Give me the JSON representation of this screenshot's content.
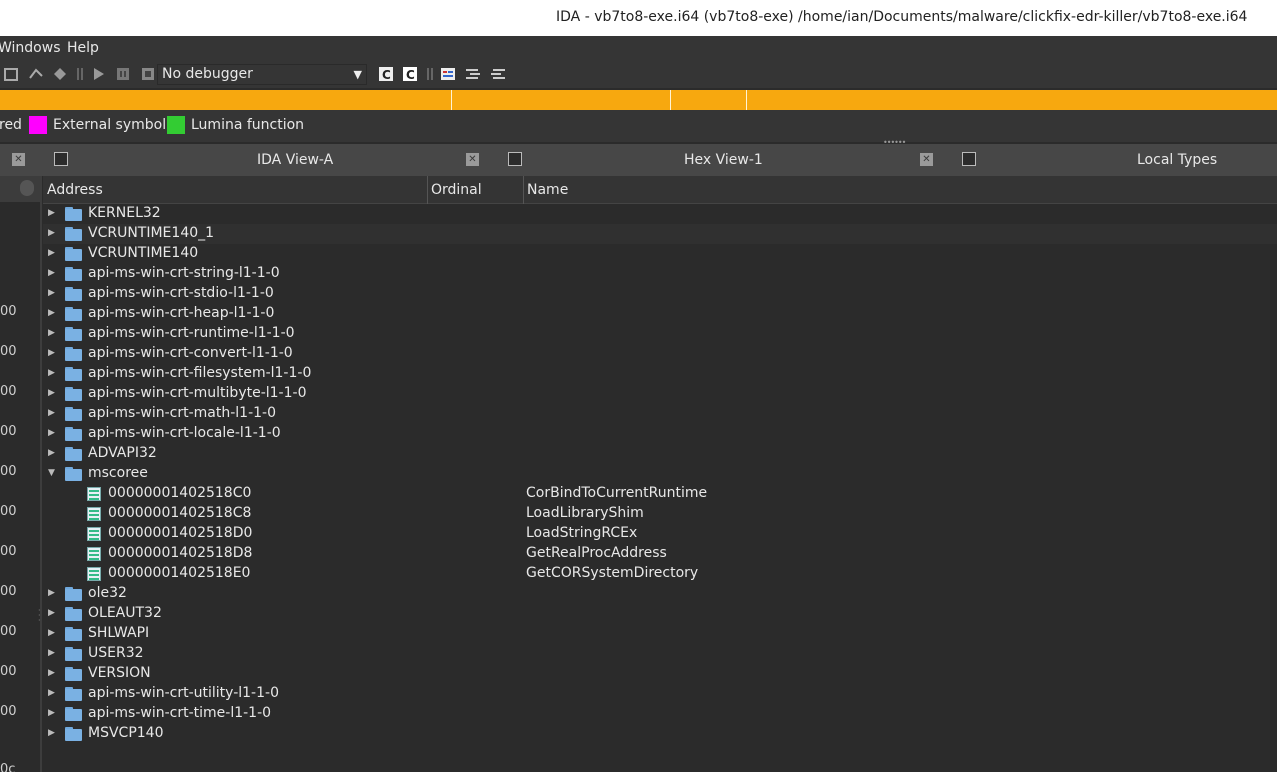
{
  "window": {
    "title": "IDA - vb7to8-exe.i64 (vb7to8-exe) /home/ian/Documents/malware/clickfix-edr-killer/vb7to8-exe.i64"
  },
  "menu": {
    "items": [
      "Windows",
      "Help"
    ]
  },
  "toolbar": {
    "debugger": "No debugger"
  },
  "legend": {
    "items": [
      {
        "label": "red",
        "color": ""
      },
      {
        "label": "External symbol",
        "color": "#ff00ff"
      },
      {
        "label": "Lumina function",
        "color": "#33cc33"
      }
    ]
  },
  "colors": {
    "nav_band": "#f7a80f",
    "folder": "#7ab1e3"
  },
  "tabs": [
    {
      "label": "IDA View-A",
      "icon": "list-icon"
    },
    {
      "label": "Hex View-1",
      "icon": "hex-icon"
    },
    {
      "label": "Local Types",
      "icon": "types-icon"
    }
  ],
  "columns": {
    "address": "Address",
    "ordinal": "Ordinal",
    "name": "Name"
  },
  "left_fragments": [
    "00",
    "00",
    "00",
    "00",
    "00",
    "00",
    "00",
    "00",
    "00",
    "00",
    "00",
    "00"
  ],
  "rows": [
    {
      "type": "folder",
      "label": "KERNEL32",
      "expanded": false
    },
    {
      "type": "folder",
      "label": "VCRUNTIME140_1",
      "expanded": false
    },
    {
      "type": "folder",
      "label": "VCRUNTIME140",
      "expanded": false
    },
    {
      "type": "folder",
      "label": "api-ms-win-crt-string-l1-1-0",
      "expanded": false
    },
    {
      "type": "folder",
      "label": "api-ms-win-crt-stdio-l1-1-0",
      "expanded": false
    },
    {
      "type": "folder",
      "label": "api-ms-win-crt-heap-l1-1-0",
      "expanded": false
    },
    {
      "type": "folder",
      "label": "api-ms-win-crt-runtime-l1-1-0",
      "expanded": false
    },
    {
      "type": "folder",
      "label": "api-ms-win-crt-convert-l1-1-0",
      "expanded": false
    },
    {
      "type": "folder",
      "label": "api-ms-win-crt-filesystem-l1-1-0",
      "expanded": false
    },
    {
      "type": "folder",
      "label": "api-ms-win-crt-multibyte-l1-1-0",
      "expanded": false
    },
    {
      "type": "folder",
      "label": "api-ms-win-crt-math-l1-1-0",
      "expanded": false
    },
    {
      "type": "folder",
      "label": "api-ms-win-crt-locale-l1-1-0",
      "expanded": false
    },
    {
      "type": "folder",
      "label": "ADVAPI32",
      "expanded": false
    },
    {
      "type": "folder",
      "label": "mscoree",
      "expanded": true
    },
    {
      "type": "func",
      "address": "00000001402518C0",
      "name": "CorBindToCurrentRuntime"
    },
    {
      "type": "func",
      "address": "00000001402518C8",
      "name": "LoadLibraryShim"
    },
    {
      "type": "func",
      "address": "00000001402518D0",
      "name": "LoadStringRCEx"
    },
    {
      "type": "func",
      "address": "00000001402518D8",
      "name": "GetRealProcAddress"
    },
    {
      "type": "func",
      "address": "00000001402518E0",
      "name": "GetCORSystemDirectory"
    },
    {
      "type": "folder",
      "label": "ole32",
      "expanded": false
    },
    {
      "type": "folder",
      "label": "OLEAUT32",
      "expanded": false
    },
    {
      "type": "folder",
      "label": "SHLWAPI",
      "expanded": false
    },
    {
      "type": "folder",
      "label": "USER32",
      "expanded": false
    },
    {
      "type": "folder",
      "label": "VERSION",
      "expanded": false
    },
    {
      "type": "folder",
      "label": "api-ms-win-crt-utility-l1-1-0",
      "expanded": false
    },
    {
      "type": "folder",
      "label": "api-ms-win-crt-time-l1-1-0",
      "expanded": false
    },
    {
      "type": "folder",
      "label": "MSVCP140",
      "expanded": false
    }
  ]
}
